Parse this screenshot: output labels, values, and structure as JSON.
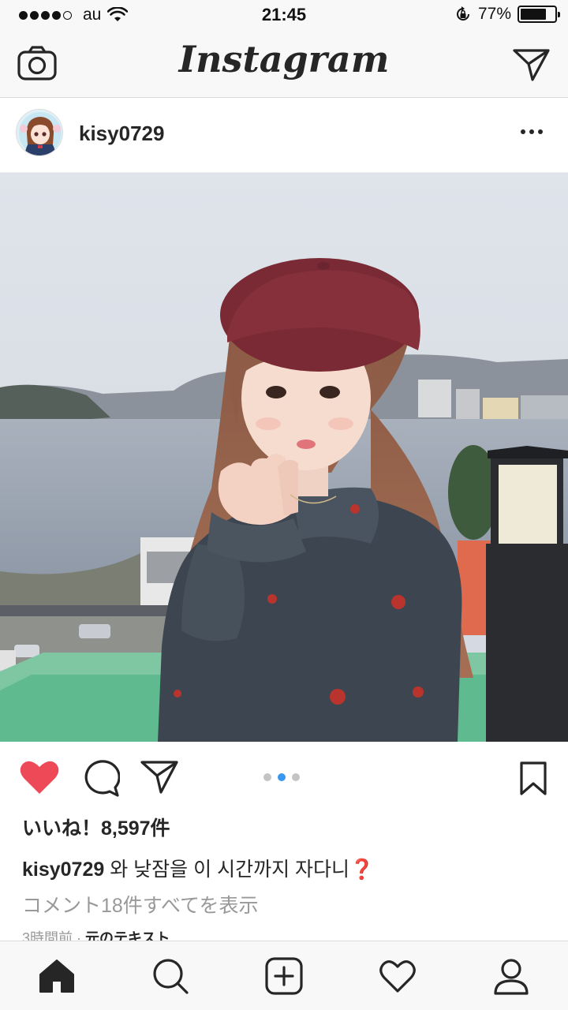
{
  "status_bar": {
    "carrier": "au",
    "time": "21:45",
    "battery_percent": "77%",
    "battery_level": 0.77,
    "icons": [
      "signal-dots-icon",
      "wifi-icon",
      "orientation-lock-icon",
      "battery-icon"
    ]
  },
  "header": {
    "app_title": "Instagram",
    "left_icon": "camera-icon",
    "right_icon": "direct-message-icon"
  },
  "post": {
    "username": "kisy0729",
    "more_icon": "more-options-icon",
    "carousel": {
      "total": 3,
      "active_index": 1
    },
    "likes_text": "いいね！8,597件",
    "caption_user": "kisy0729",
    "caption_text": " 와 낮잠을 이 시간까지 자다니❓",
    "view_comments": "コメント18件すべてを表示",
    "time_ago": "3時間前 · ",
    "translate_label": "元のテキスト",
    "liked": true,
    "colors": {
      "like_red": "#ed4956",
      "carousel_active": "#3897f0"
    }
  },
  "tab_bar": {
    "tabs": [
      "home-icon",
      "search-icon",
      "new-post-icon",
      "activity-icon",
      "profile-icon"
    ]
  }
}
